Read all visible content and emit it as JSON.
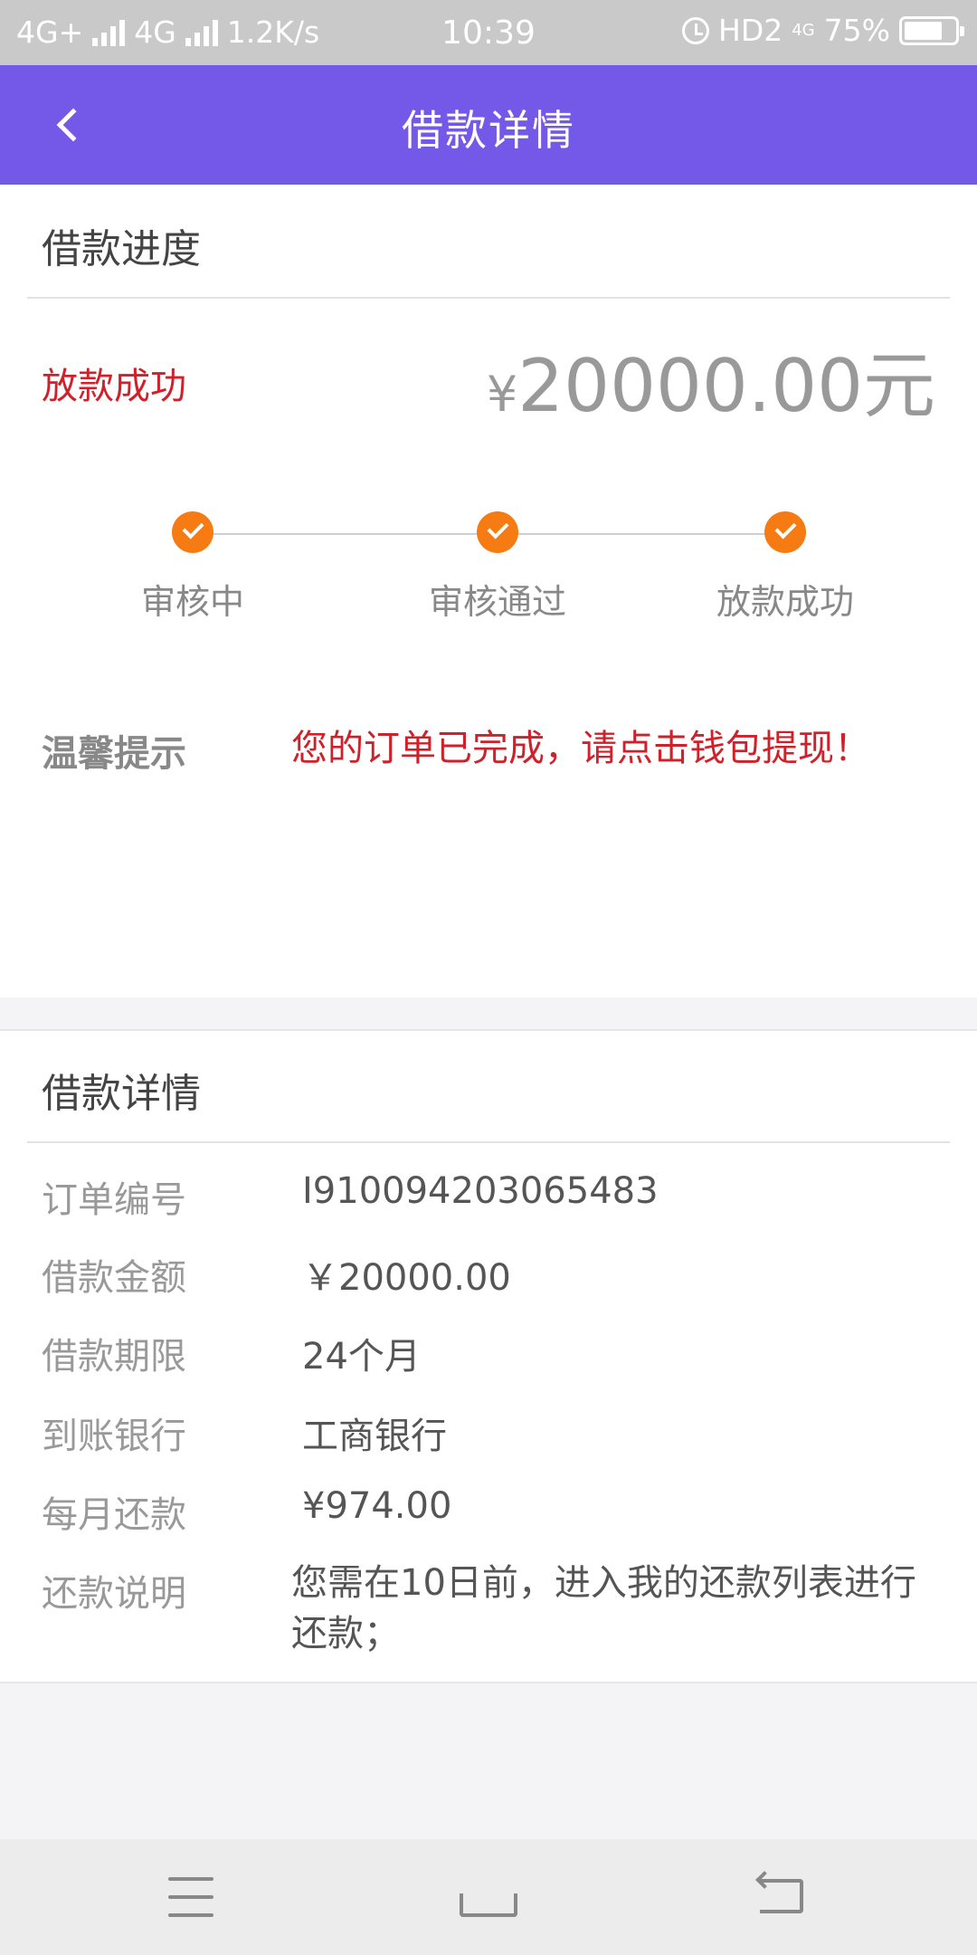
{
  "status_bar": {
    "network1": "4G+",
    "network2": "4G",
    "speed": "1.2K/s",
    "time": "10:39",
    "hd": "HD2",
    "network3": "4G",
    "battery": "75%",
    "battery_level": 0.75
  },
  "header": {
    "title": "借款详情",
    "back_icon": "chevron-left-icon"
  },
  "progress": {
    "section_title": "借款进度",
    "status": "放款成功",
    "currency": "¥",
    "amount": "20000.00元",
    "steps": [
      {
        "label": "审核中",
        "done": true
      },
      {
        "label": "审核通过",
        "done": true
      },
      {
        "label": "放款成功",
        "done": true
      }
    ],
    "tip_label": "温馨提示",
    "tip_text": "您的订单已完成，请点击钱包提现！"
  },
  "details": {
    "section_title": "借款详情",
    "rows": [
      {
        "label": "订单编号",
        "value": "I910094203065483"
      },
      {
        "label": "借款金额",
        "value": "￥20000.00"
      },
      {
        "label": "借款期限",
        "value": "24个月"
      },
      {
        "label": "到账银行",
        "value": "工商银行"
      },
      {
        "label": "每月还款",
        "value": "¥974.00"
      }
    ],
    "note_label": "还款说明",
    "note_value": "您需在10日前，进入我的还款列表进行还款；"
  },
  "accent_colors": {
    "header": "#7458e8",
    "status_red": "#d0202a",
    "step_orange": "#f57b12"
  },
  "nav_bar": {
    "icons": [
      "menu-icon",
      "home-icon",
      "return-icon"
    ]
  }
}
